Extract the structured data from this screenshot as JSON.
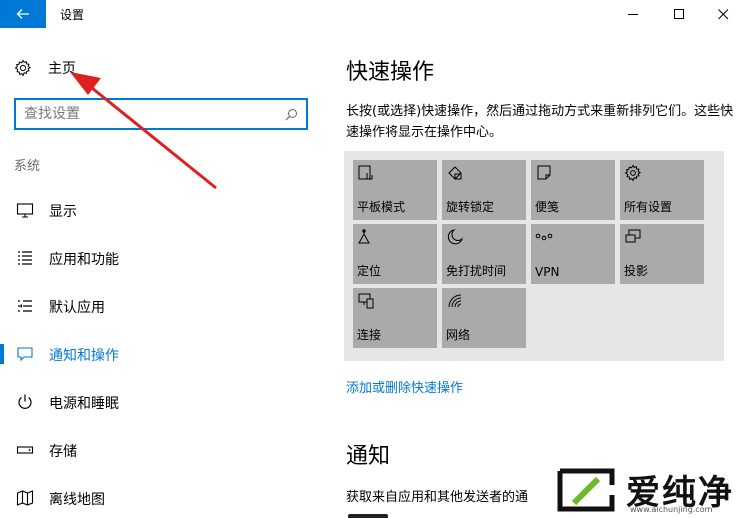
{
  "window": {
    "title": "设置",
    "back_icon": "back-arrow-icon",
    "accent": "#0078d7"
  },
  "sidebar": {
    "home_label": "主页",
    "search_placeholder": "查找设置",
    "group_label": "系统",
    "items": [
      {
        "label": "显示",
        "icon": "display-icon"
      },
      {
        "label": "应用和功能",
        "icon": "apps-list-icon"
      },
      {
        "label": "默认应用",
        "icon": "default-apps-icon"
      },
      {
        "label": "通知和操作",
        "icon": "notification-icon",
        "active": true
      },
      {
        "label": "电源和睡眠",
        "icon": "power-icon"
      },
      {
        "label": "存储",
        "icon": "storage-icon"
      },
      {
        "label": "离线地图",
        "icon": "offline-map-icon"
      }
    ]
  },
  "main": {
    "title": "快速操作",
    "description": "长按(或选择)快速操作，然后通过拖动方式来重新排列它们。这些快速操作将显示在操作中心。",
    "tiles": [
      {
        "label": "平板模式",
        "icon": "tablet-mode-icon"
      },
      {
        "label": "旋转锁定",
        "icon": "rotation-lock-icon"
      },
      {
        "label": "便笺",
        "icon": "note-icon"
      },
      {
        "label": "所有设置",
        "icon": "settings-gear-icon"
      },
      {
        "label": "定位",
        "icon": "location-icon"
      },
      {
        "label": "免打扰时间",
        "icon": "moon-icon"
      },
      {
        "label": "VPN",
        "icon": "vpn-icon"
      },
      {
        "label": "投影",
        "icon": "project-icon"
      },
      {
        "label": "连接",
        "icon": "connect-icon"
      },
      {
        "label": "网络",
        "icon": "network-icon"
      }
    ],
    "add_remove_link": "添加或删除快速操作",
    "notifications_title": "通知",
    "notifications_text": "获取来自应用和其他发送者的通"
  },
  "watermark": {
    "name": "爱纯净",
    "url": "www.aichunjing.com"
  }
}
